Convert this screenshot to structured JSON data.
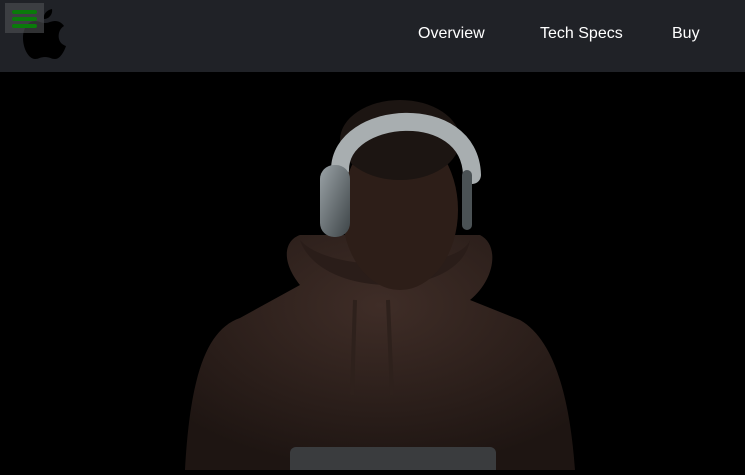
{
  "header": {
    "logo": "apple-logo",
    "menu_icon": "hamburger-icon",
    "menu_color": "#0a7a0a",
    "nav": [
      {
        "label": "Overview"
      },
      {
        "label": "Tech Specs"
      },
      {
        "label": "Buy"
      }
    ]
  },
  "hero": {
    "image": "person-wearing-headphones"
  }
}
